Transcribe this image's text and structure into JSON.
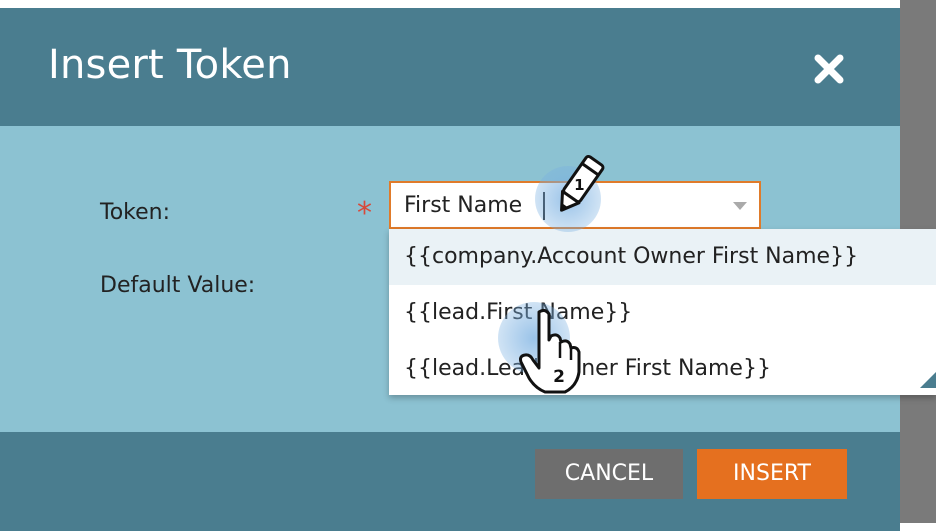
{
  "dialog": {
    "title": "Insert Token",
    "close_icon": "close-icon"
  },
  "form": {
    "token_label": "Token:",
    "required_marker": "*",
    "token_value": "First Name",
    "default_value_label": "Default Value:"
  },
  "dropdown": {
    "options": [
      "{{company.Account Owner First Name}}",
      "{{lead.First Name}}",
      "{{lead.Lead Owner First Name}}"
    ]
  },
  "footer": {
    "cancel_label": "CANCEL",
    "insert_label": "INSERT"
  },
  "annotations": {
    "step1": "1",
    "step2": "2"
  },
  "colors": {
    "header": "#4a7d8f",
    "body": "#8cc2d2",
    "accent": "#e5701f",
    "required": "#d8493a",
    "cancel": "#6e6e6e"
  }
}
